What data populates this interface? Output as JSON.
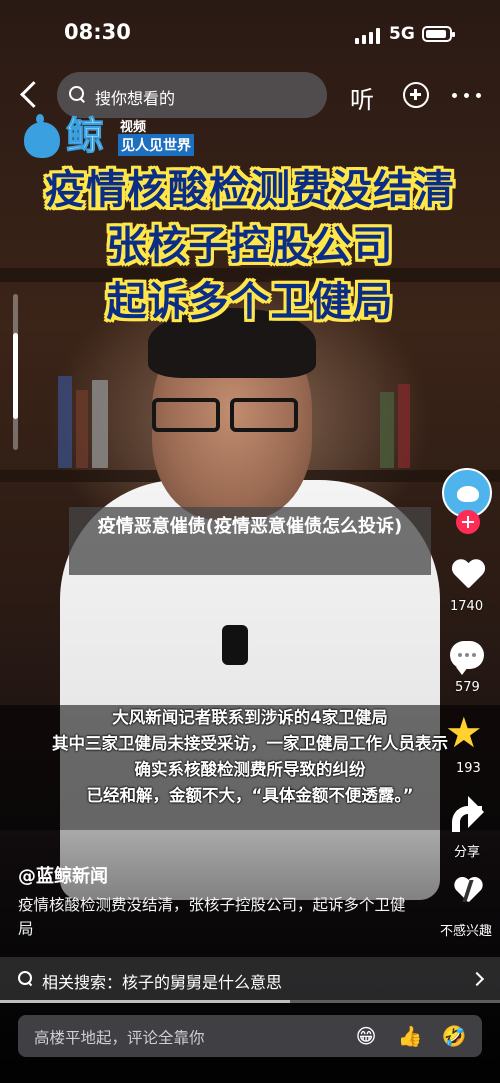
{
  "status_bar": {
    "time": "08:30",
    "network": "5G"
  },
  "top_bar": {
    "search_placeholder": "搜你想看的",
    "listen_label": "听"
  },
  "logo": {
    "name": "鲸",
    "line1": "视频",
    "line2": "见人见世界"
  },
  "video": {
    "headline": [
      "疫情核酸检测费没结清",
      "张核子控股公司",
      "起诉多个卫健局"
    ],
    "overlay_title": "疫情恶意催债(疫情恶意催债怎么投诉)",
    "subtitles": [
      "大风新闻记者联系到涉诉的4家卫健局",
      "其中三家卫健局未接受采访，一家卫健局工作人员表示",
      "确实系核酸检测费所导致的纠纷",
      "已经和解，金额不大，“具体金额不便透露。”"
    ],
    "scroll_indicator_fraction": 0.55
  },
  "actions": {
    "likes": "1740",
    "comments": "579",
    "favorites": "193",
    "share_label": "分享",
    "dislike_label": "不感兴趣"
  },
  "post": {
    "author": "@蓝鲸新闻",
    "description": "疫情核酸检测费没结清，张核子控股公司，起诉多个卫健局"
  },
  "related_search": {
    "label": "相关搜索：核子的舅舅是什么意思"
  },
  "playback_progress": 0.58,
  "comment_bar": {
    "placeholder": "高楼平地起，评论全靠你",
    "emojis": [
      "😁",
      "👍",
      "🤣"
    ]
  },
  "colors": {
    "headline_text": "#0b2d86",
    "headline_stroke": "#ffe74a",
    "follow_badge": "#ff2c55",
    "favorite_star": "#ffd230"
  }
}
